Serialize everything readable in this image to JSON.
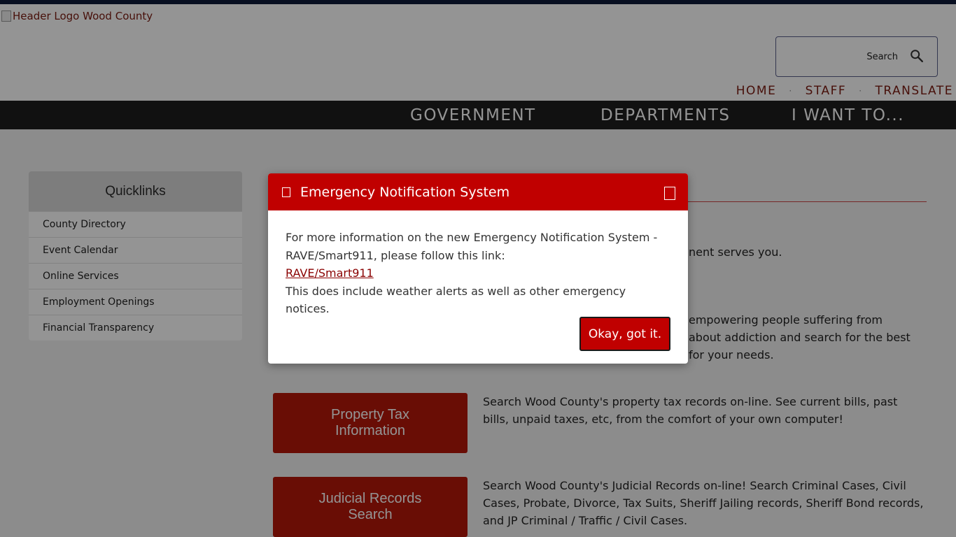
{
  "header": {
    "logo_alt": "Header Logo Wood County",
    "search_label": "Search",
    "utility_nav": [
      "HOME",
      "STAFF",
      "TRANSLATE"
    ]
  },
  "mainnav": {
    "items": [
      "GOVERNMENT",
      "DEPARTMENTS",
      "I WANT TO..."
    ]
  },
  "quicklinks": {
    "title": "Quicklinks",
    "items": [
      "County Directory",
      "Event Calendar",
      "Online Services",
      "Employment Openings",
      "Financial Transparency"
    ]
  },
  "content": {
    "intro_fragment": "nent serves you.",
    "addiction_lines": [
      "empowering people suffering from",
      "about addiction and search for the best",
      "for your needs."
    ],
    "property_tax": {
      "button": "Property Tax Information",
      "description": "Search Wood County's property tax records on-line. See current bills, past bills, unpaid taxes, etc, from the comfort of your own computer!"
    },
    "judicial": {
      "button": "Judicial Records Search",
      "description": "Search Wood County's Judicial Records on-line! Search Criminal Cases, Civil Cases, Probate, Divorce, Tax Suits, Sheriff Jailing records, Sheriff Bond records, and JP Criminal / Traffic / Civil Cases."
    }
  },
  "modal": {
    "title": "Emergency Notification System",
    "line1": "For more information on the new Emergency Notification System - RAVE/Smart911, please follow this link:",
    "link": "RAVE/Smart911",
    "line2": "This does include weather alerts as well as other emergency notices.",
    "button": "Okay, got it."
  },
  "colors": {
    "brand_red": "#c00000",
    "button_red": "#b5180a",
    "nav_dark": "#1e1e1e"
  }
}
